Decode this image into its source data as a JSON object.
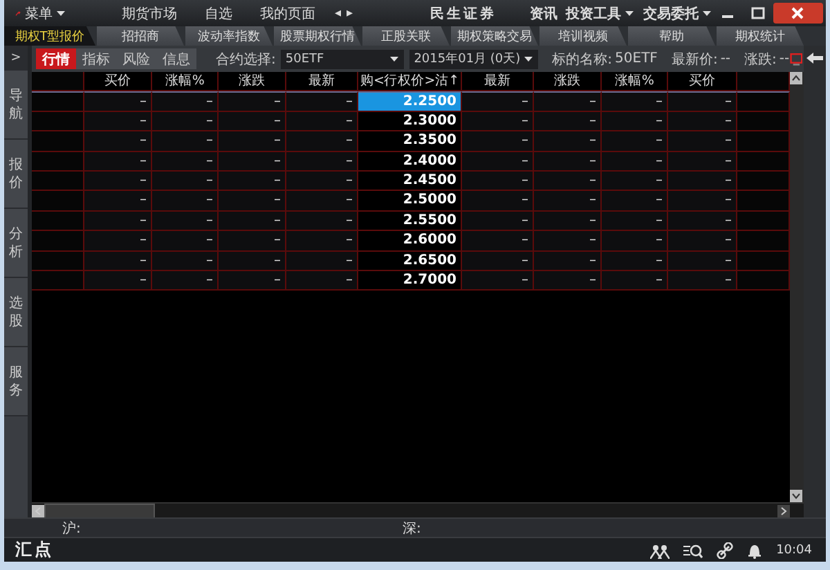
{
  "menu_button": "菜单",
  "top_menu": [
    "期货市场",
    "自选",
    "我的页面"
  ],
  "nav_arrows": [
    "◂",
    "▸"
  ],
  "brand": "民生证券",
  "right_menu": [
    {
      "label": "资讯",
      "dropdown": false
    },
    {
      "label": "投资工具",
      "dropdown": true
    },
    {
      "label": "交易委托",
      "dropdown": true
    }
  ],
  "tabs": [
    {
      "label": "期权T型报价",
      "selected": true
    },
    {
      "label": "招招商",
      "selected": false
    },
    {
      "label": "波动率指数",
      "selected": false
    },
    {
      "label": "股票期权行情",
      "selected": false
    },
    {
      "label": "正股关联",
      "selected": false
    },
    {
      "label": "期权策略交易",
      "selected": false
    },
    {
      "label": "培训视频",
      "selected": false
    },
    {
      "label": "帮助",
      "selected": false
    },
    {
      "label": "期权统计",
      "selected": false
    }
  ],
  "sidebar": {
    "toggle": ">",
    "items": [
      "导航",
      "报价",
      "分析",
      "选股",
      "服务"
    ]
  },
  "subtabs": [
    {
      "label": "行情",
      "selected": true
    },
    {
      "label": "指标",
      "selected": false
    },
    {
      "label": "风险",
      "selected": false
    },
    {
      "label": "信息",
      "selected": false
    }
  ],
  "contract": {
    "label": "合约选择:",
    "underlying": "50ETF",
    "month": "2015年01月 (0天)"
  },
  "info": [
    {
      "label": "标的名称:",
      "value": "50ETF"
    },
    {
      "label": "最新价:",
      "value": "--"
    },
    {
      "label": "涨跌:",
      "value": "--"
    }
  ],
  "table": {
    "columns": [
      "买价",
      "涨幅%",
      "涨跌",
      "最新",
      "购<行权价>沽↑",
      "最新",
      "涨跌",
      "涨幅%",
      "买价"
    ],
    "rows": [
      {
        "call": [
          "–",
          "–",
          "–",
          "–"
        ],
        "strike": "2.2500",
        "put": [
          "–",
          "–",
          "–",
          "–"
        ],
        "selected": true
      },
      {
        "call": [
          "–",
          "–",
          "–",
          "–"
        ],
        "strike": "2.3000",
        "put": [
          "–",
          "–",
          "–",
          "–"
        ],
        "selected": false
      },
      {
        "call": [
          "–",
          "–",
          "–",
          "–"
        ],
        "strike": "2.3500",
        "put": [
          "–",
          "–",
          "–",
          "–"
        ],
        "selected": false
      },
      {
        "call": [
          "–",
          "–",
          "–",
          "–"
        ],
        "strike": "2.4000",
        "put": [
          "–",
          "–",
          "–",
          "–"
        ],
        "selected": false
      },
      {
        "call": [
          "–",
          "–",
          "–",
          "–"
        ],
        "strike": "2.4500",
        "put": [
          "–",
          "–",
          "–",
          "–"
        ],
        "selected": false
      },
      {
        "call": [
          "–",
          "–",
          "–",
          "–"
        ],
        "strike": "2.5000",
        "put": [
          "–",
          "–",
          "–",
          "–"
        ],
        "selected": false
      },
      {
        "call": [
          "–",
          "–",
          "–",
          "–"
        ],
        "strike": "2.5500",
        "put": [
          "–",
          "–",
          "–",
          "–"
        ],
        "selected": false
      },
      {
        "call": [
          "–",
          "–",
          "–",
          "–"
        ],
        "strike": "2.6000",
        "put": [
          "–",
          "–",
          "–",
          "–"
        ],
        "selected": false
      },
      {
        "call": [
          "–",
          "–",
          "–",
          "–"
        ],
        "strike": "2.6500",
        "put": [
          "–",
          "–",
          "–",
          "–"
        ],
        "selected": false
      },
      {
        "call": [
          "–",
          "–",
          "–",
          "–"
        ],
        "strike": "2.7000",
        "put": [
          "–",
          "–",
          "–",
          "–"
        ],
        "selected": false
      }
    ]
  },
  "index_bar": [
    "沪:",
    "深:"
  ],
  "status_bar": {
    "logo": "汇点",
    "time": "10:04"
  }
}
